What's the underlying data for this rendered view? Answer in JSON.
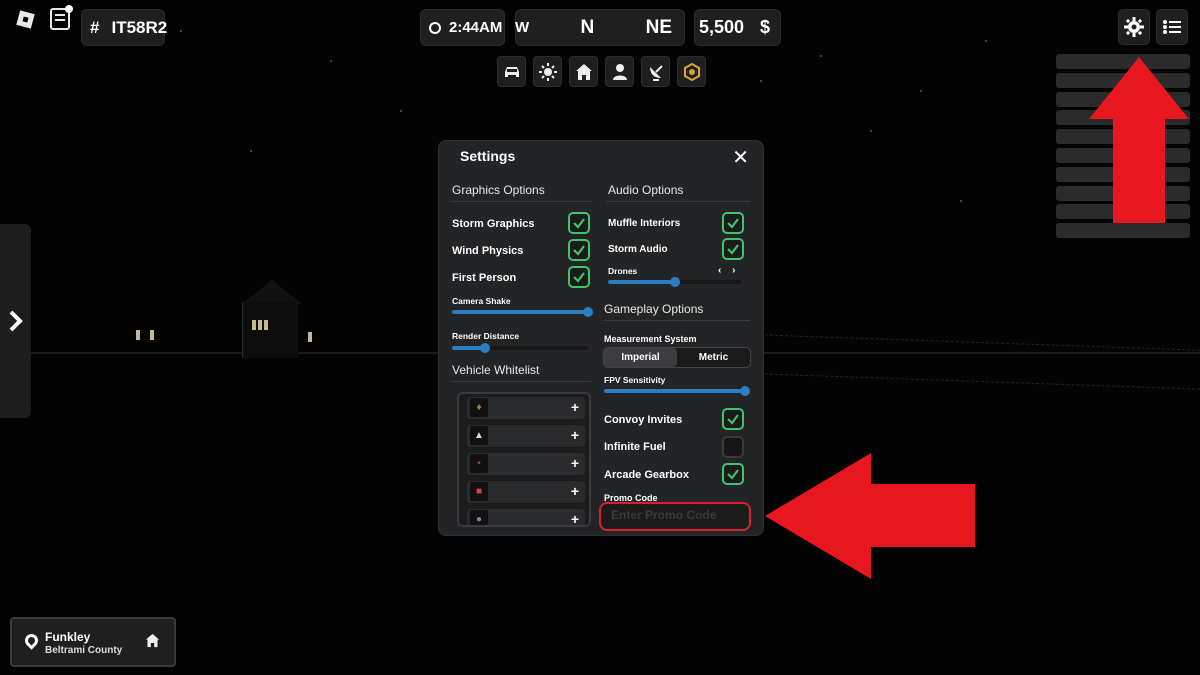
{
  "hud": {
    "server_hash": "#",
    "server_code": "IT58R2",
    "time": "2:44AM",
    "compass": {
      "left": "W",
      "center": "N",
      "right": "NE"
    },
    "money_amount": "5,500",
    "money_symbol": "$"
  },
  "quick_buttons": [
    "car-icon",
    "sun-icon",
    "home-icon",
    "person-icon",
    "satellite-icon",
    "badge-icon"
  ],
  "location": {
    "city": "Funkley",
    "county": "Beltrami County"
  },
  "settings": {
    "title": "Settings",
    "close": "✕",
    "graphics": {
      "heading": "Graphics Options",
      "storm_graphics": {
        "label": "Storm Graphics",
        "checked": true
      },
      "wind_physics": {
        "label": "Wind Physics",
        "checked": true
      },
      "first_person": {
        "label": "First Person",
        "checked": true
      },
      "camera_shake": {
        "label": "Camera Shake",
        "value": 1.0
      },
      "render_distance": {
        "label": "Render Distance",
        "value": 0.24
      }
    },
    "audio": {
      "heading": "Audio Options",
      "muffle_interiors": {
        "label": "Muffle Interiors",
        "checked": true
      },
      "storm_audio": {
        "label": "Storm Audio",
        "checked": true
      },
      "drones": {
        "label": "Drones",
        "value": 0.5,
        "arrows": "‹ ›"
      }
    },
    "gameplay": {
      "heading": "Gameplay Options",
      "measurement_label": "Measurement System",
      "measurement_options": [
        "Imperial",
        "Metric"
      ],
      "measurement_selected": "Imperial",
      "fpv_sensitivity": {
        "label": "FPV Sensitivity",
        "value": 1.0
      },
      "convoy_invites": {
        "label": "Convoy Invites",
        "checked": true
      },
      "infinite_fuel": {
        "label": "Infinite Fuel",
        "checked": false
      },
      "arcade_gearbox": {
        "label": "Arcade Gearbox",
        "checked": true
      },
      "promo_label": "Promo Code",
      "promo_placeholder": "Enter Promo Code"
    },
    "vehicle_whitelist": {
      "heading": "Vehicle Whitelist",
      "add": "+"
    }
  },
  "colors": {
    "check_green": "#3ec46a",
    "slider_blue": "#2c7ec2",
    "annotation_red": "#d91f2a"
  }
}
